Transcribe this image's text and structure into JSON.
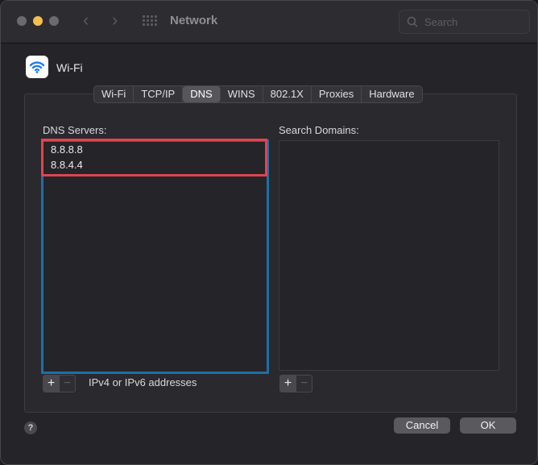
{
  "window": {
    "title": "Network"
  },
  "toolbar": {
    "back": "‹",
    "forward": "›",
    "search_placeholder": "Search"
  },
  "interface": {
    "name": "Wi-Fi",
    "icon": "wifi-icon"
  },
  "tabs": [
    {
      "label": "Wi-Fi",
      "active": false
    },
    {
      "label": "TCP/IP",
      "active": false
    },
    {
      "label": "DNS",
      "active": true
    },
    {
      "label": "WINS",
      "active": false
    },
    {
      "label": "802.1X",
      "active": false
    },
    {
      "label": "Proxies",
      "active": false
    },
    {
      "label": "Hardware",
      "active": false
    }
  ],
  "dns": {
    "label": "DNS Servers:",
    "servers": [
      "8.8.8.8",
      "8.8.4.4"
    ],
    "add": "+",
    "remove": "−",
    "hint": "IPv4 or IPv6 addresses"
  },
  "search_domains": {
    "label": "Search Domains:",
    "add": "+",
    "remove": "−"
  },
  "footer": {
    "help": "?",
    "cancel": "Cancel",
    "ok": "OK"
  },
  "colors": {
    "highlight": "#e0444f",
    "focus": "#1e6fa8",
    "accent": "#f4bf4f",
    "wifi": "#1a7df0"
  }
}
